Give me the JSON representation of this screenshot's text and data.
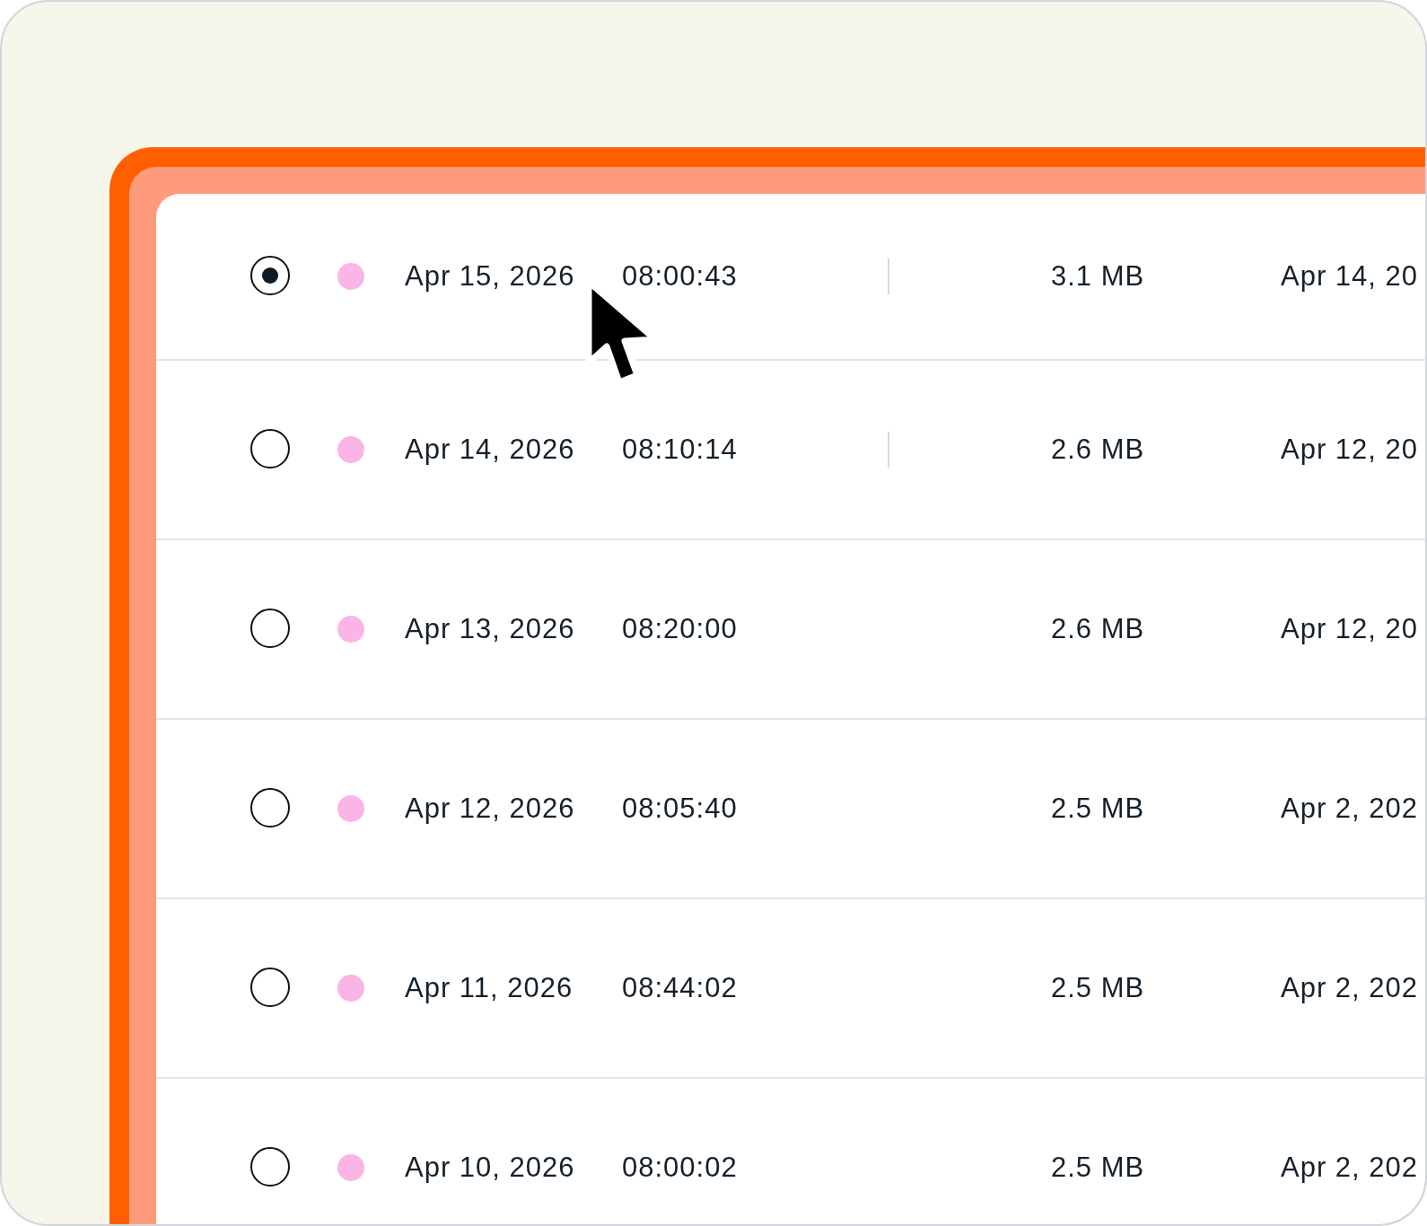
{
  "rows": [
    {
      "selected": true,
      "color": "#fbb4e6",
      "date": "Apr 15, 2026",
      "time": "08:00:43",
      "column_divider": true,
      "size": "3.1 MB",
      "column_5": "Apr 14, 20"
    },
    {
      "selected": false,
      "color": "#fbb4e6",
      "date": "Apr 14, 2026",
      "time": "08:10:14",
      "column_divider": true,
      "size": "2.6 MB",
      "column_5": "Apr 12, 20"
    },
    {
      "selected": false,
      "color": "#fbb4e6",
      "date": "Apr 13, 2026",
      "time": "08:20:00",
      "column_divider": false,
      "size": "2.6 MB",
      "column_5": "Apr 12, 20"
    },
    {
      "selected": false,
      "color": "#fbb4e6",
      "date": "Apr 12, 2026",
      "time": "08:05:40",
      "column_divider": false,
      "size": "2.5 MB",
      "column_5": "Apr 2, 202"
    },
    {
      "selected": false,
      "color": "#fbb4e6",
      "date": "Apr 11, 2026",
      "time": "08:44:02",
      "column_divider": false,
      "size": "2.5 MB",
      "column_5": "Apr 2, 202"
    },
    {
      "selected": false,
      "color": "#fbb4e6",
      "date": "Apr 10, 2026",
      "time": "08:00:02",
      "column_divider": false,
      "size": "2.5 MB",
      "column_5": "Apr 2, 202"
    }
  ]
}
